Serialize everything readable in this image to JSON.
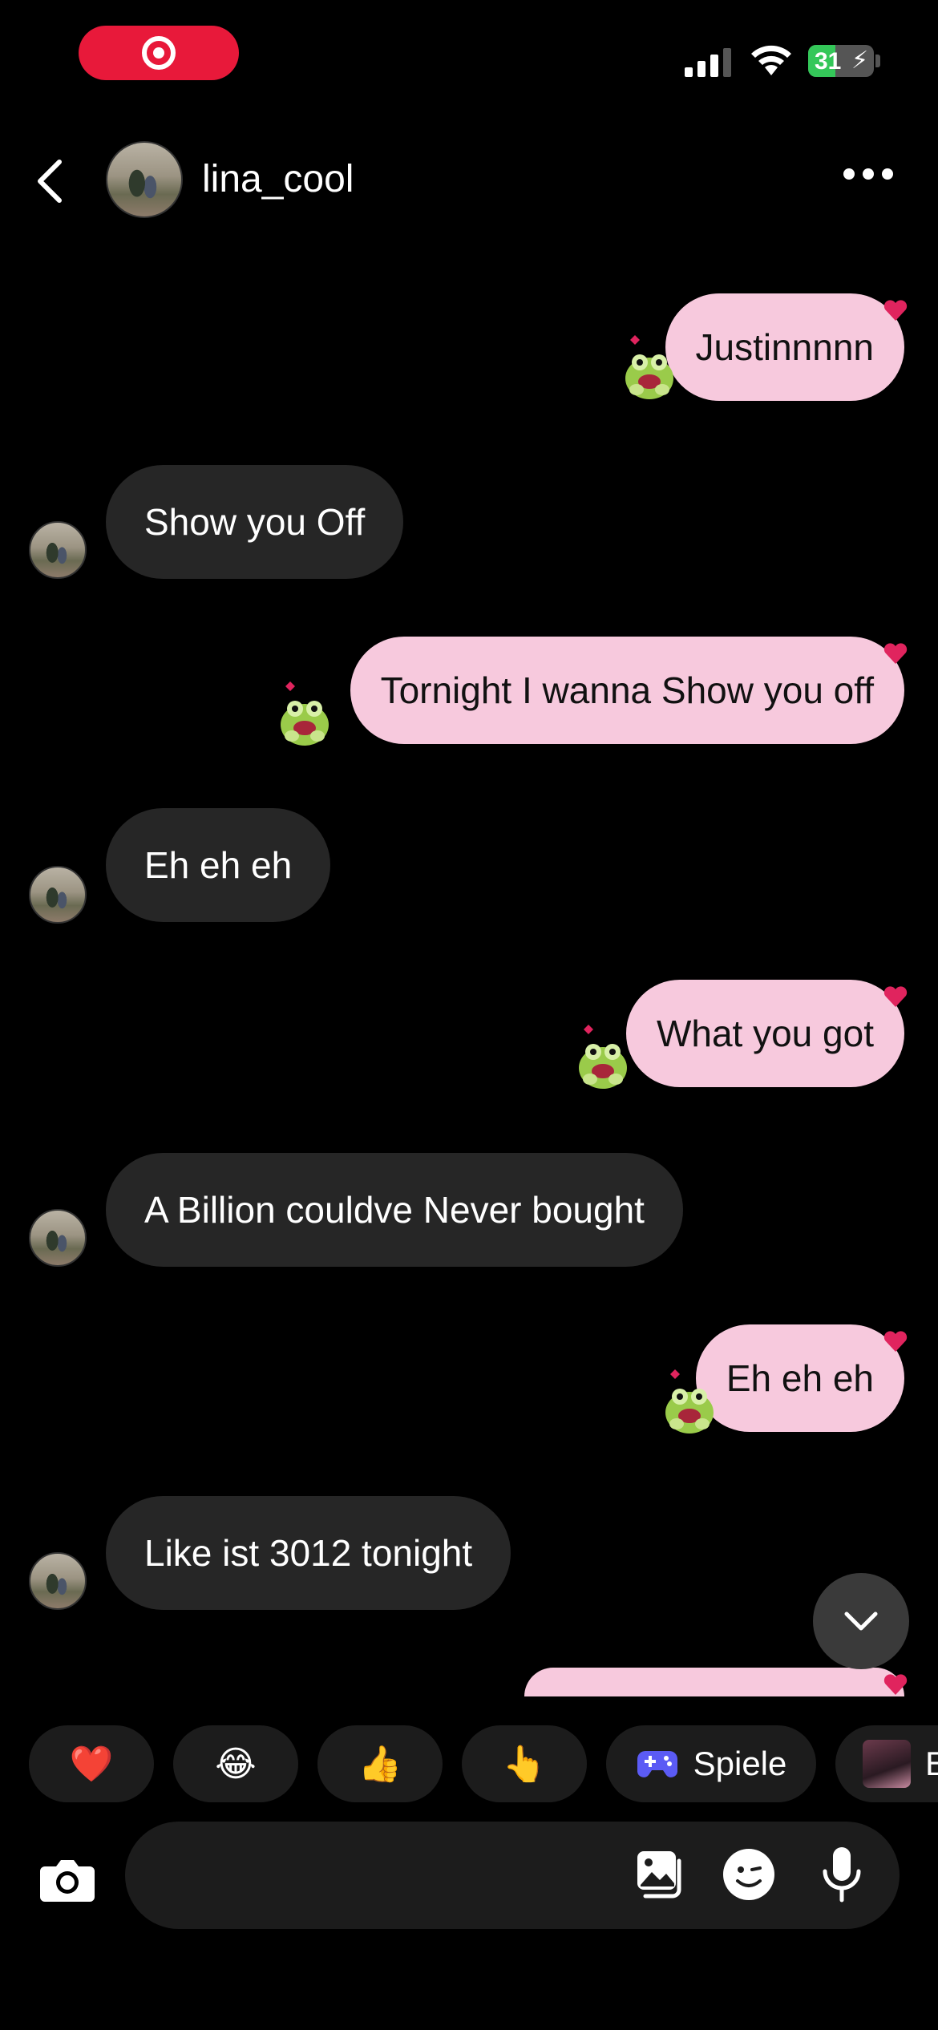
{
  "status_bar": {
    "battery_percent": "31",
    "recording_icon": "record-icon",
    "signal_icon": "cellular-signal-icon",
    "wifi_icon": "wifi-icon",
    "charging": true
  },
  "header": {
    "back_icon": "chevron-left-icon",
    "username": "lina_cool",
    "more_icon": "more-horizontal-icon"
  },
  "messages": [
    {
      "direction": "outgoing",
      "text": "Justinnnnn",
      "reaction": "heart",
      "sticker": "frog-sticker"
    },
    {
      "direction": "incoming",
      "text": "Show you Off"
    },
    {
      "direction": "outgoing",
      "text": "Tornight I wanna Show you off",
      "reaction": "heart",
      "sticker": "frog-sticker"
    },
    {
      "direction": "incoming",
      "text": "Eh eh eh"
    },
    {
      "direction": "outgoing",
      "text": "What you got",
      "reaction": "heart",
      "sticker": "frog-sticker"
    },
    {
      "direction": "incoming",
      "text": "A Billion couldve Never bought"
    },
    {
      "direction": "outgoing",
      "text": "Eh eh eh",
      "reaction": "heart",
      "sticker": "frog-sticker"
    },
    {
      "direction": "incoming",
      "text": "Like ist 3012 tonight"
    }
  ],
  "scroll_down_icon": "chevron-down-icon",
  "quick_reactions": [
    {
      "emoji": "❤️",
      "name": "heart"
    },
    {
      "emoji": "😂",
      "name": "laughing"
    },
    {
      "emoji": "👍",
      "name": "thumbs-up"
    },
    {
      "emoji": "👆",
      "name": "pointing-up"
    }
  ],
  "games_chip": {
    "label": "Spiele",
    "icon": "gamepad-icon"
  },
  "effect_chip": {
    "label": "E"
  },
  "composer": {
    "placeholder": "",
    "camera_icon": "camera-icon",
    "gallery_icon": "gallery-icon",
    "sticker_icon": "sticker-icon",
    "mic_icon": "microphone-icon"
  },
  "colors": {
    "background": "#000000",
    "outgoing_bubble": "#f7c9dd",
    "incoming_bubble": "#262626",
    "record_pill": "#e8193a",
    "battery_green": "#34c759",
    "gamepad": "#5b5bf5"
  }
}
